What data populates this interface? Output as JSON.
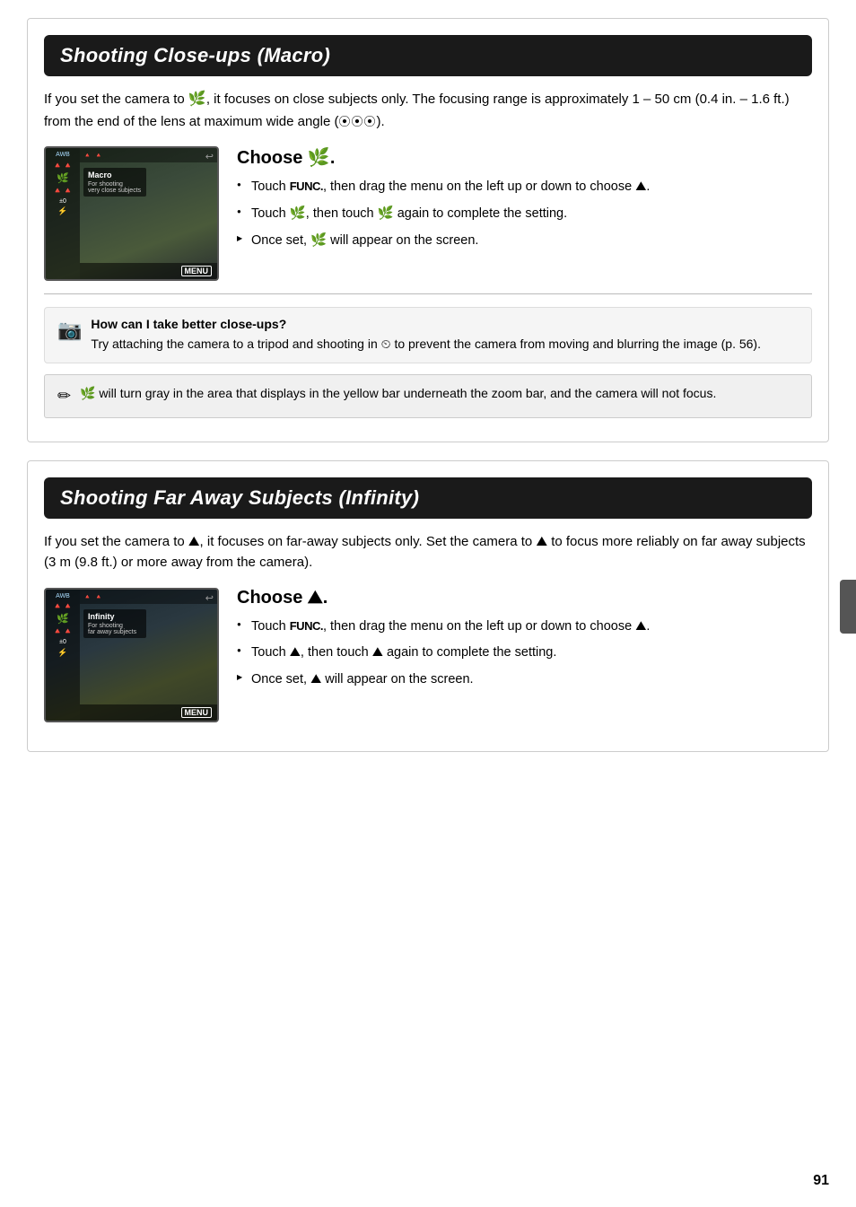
{
  "page": {
    "number": "91"
  },
  "section1": {
    "title": "Shooting Close-ups (Macro)",
    "intro": "If you set the camera to 🌿, it focuses on close subjects only. The focusing range is approximately 1 – 50 cm (0.4 in. – 1.6 ft.) from the end of the lens at maximum wide angle (⦿⦿⦿).",
    "choose_heading": "Choose 🌿.",
    "bullets": [
      "Touch FUNC., then drag the menu on the left up or down to choose 🔺.",
      "Touch 🌿, then touch 🌿 again to complete the setting.",
      "Once set, 🌿 will appear on the screen."
    ],
    "tip": {
      "title": "How can I take better close-ups?",
      "body": "Try attaching the camera to a tripod and shooting in ⏱ to prevent the camera from moving and blurring the image (p. 56)."
    },
    "note": "🌿 will turn gray in the area that displays in the yellow bar underneath the zoom bar, and the camera will not focus.",
    "camera": {
      "label": "Macro",
      "sublabel": "For shooting very close subjects"
    }
  },
  "section2": {
    "title": "Shooting Far Away Subjects (Infinity)",
    "intro": "If you set the camera to 🔺, it focuses on far-away subjects only. Set the camera to 🔺 to focus more reliably on far away subjects (3 m (9.8 ft.) or more away from the camera).",
    "choose_heading": "Choose 🔺.",
    "bullets": [
      "Touch FUNC., then drag the menu on the left up or down to choose 🔺.",
      "Touch 🔺, then touch 🔺 again to complete the setting.",
      "Once set, 🔺 will appear on the screen."
    ],
    "camera": {
      "label": "Infinity",
      "sublabel": "For shooting far away subjects"
    }
  }
}
